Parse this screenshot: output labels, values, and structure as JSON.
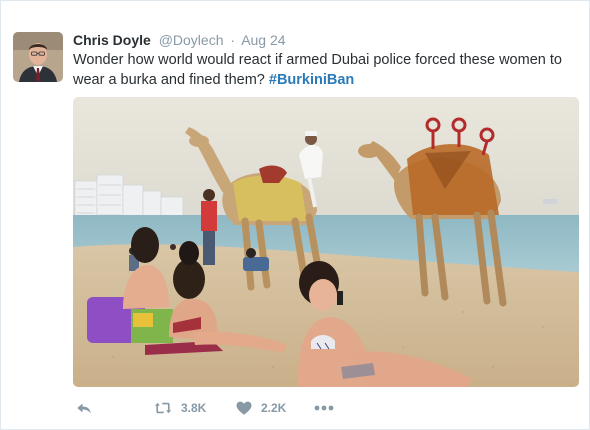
{
  "tweet": {
    "author": {
      "name": "Chris Doyle",
      "handle": "@Doylech",
      "separator": "·",
      "date": "Aug 24"
    },
    "text": "Wonder how world would react if armed Dubai police forced these women to wear a burka and fined them? ",
    "hashtag": "#BurkiniBan",
    "media": {
      "icons": [
        "camel-silhouette",
        "beach-umbrella"
      ]
    },
    "actions": {
      "reply": {
        "icon": "reply-icon"
      },
      "retweet": {
        "icon": "retweet-icon",
        "count": "3.8K"
      },
      "like": {
        "icon": "heart-icon",
        "count": "2.2K"
      },
      "more": {
        "icon": "more-icon"
      }
    },
    "colors": {
      "link": "#2b7bb9",
      "muted": "#8899a6",
      "text": "#292f33",
      "border": "#e1e8ed"
    }
  }
}
